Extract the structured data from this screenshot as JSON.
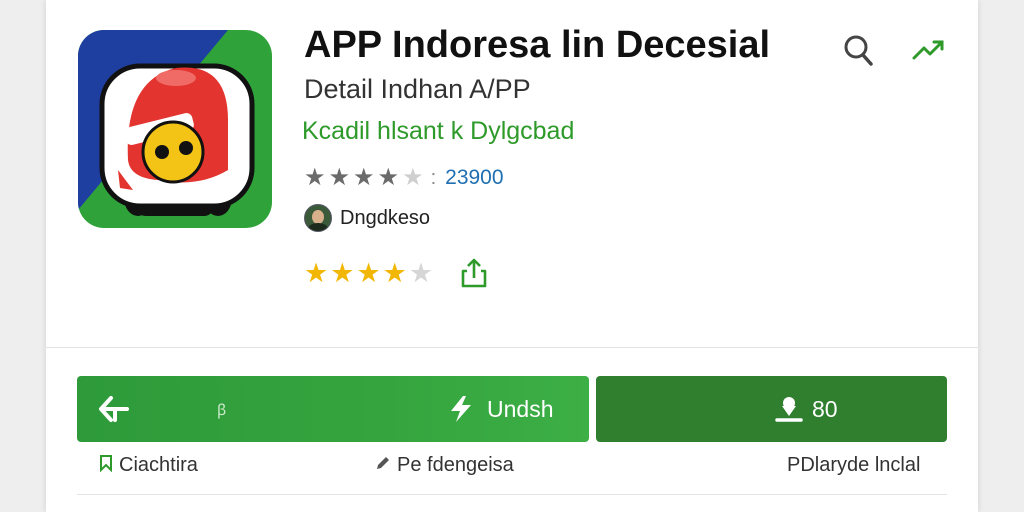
{
  "app": {
    "title": "APP Indoresa lin Decesial",
    "subtitle": "Detail Indhan A/PP",
    "tagline": "Kcadil hlsant  k Dylgcbad",
    "rating_separator": ":",
    "rating_count": "23900",
    "rating_stars": 4,
    "developer": "Dngdkeso",
    "user_rating_stars": 4
  },
  "icons": {
    "search": "search-icon",
    "trend": "trend-icon",
    "share": "share-icon",
    "back": "back-arrow-icon",
    "bolt": "lightning-icon",
    "download": "download-icon",
    "bookmark": "bookmark-icon",
    "edit": "pencil-icon"
  },
  "actions": {
    "main_mini_label": "ꞵ",
    "main_label": "Undsh",
    "download_label": "80"
  },
  "links": {
    "left": "Ciachtira",
    "middle": "Pe fdengeisa",
    "right": "PDlaryde lnclal"
  },
  "colors": {
    "accent_green": "#35a43e",
    "dark_green": "#2f7f2f",
    "tagline_green": "#2e9a2a",
    "count_blue": "#1f6fb2",
    "star_gold": "#f2b705"
  }
}
